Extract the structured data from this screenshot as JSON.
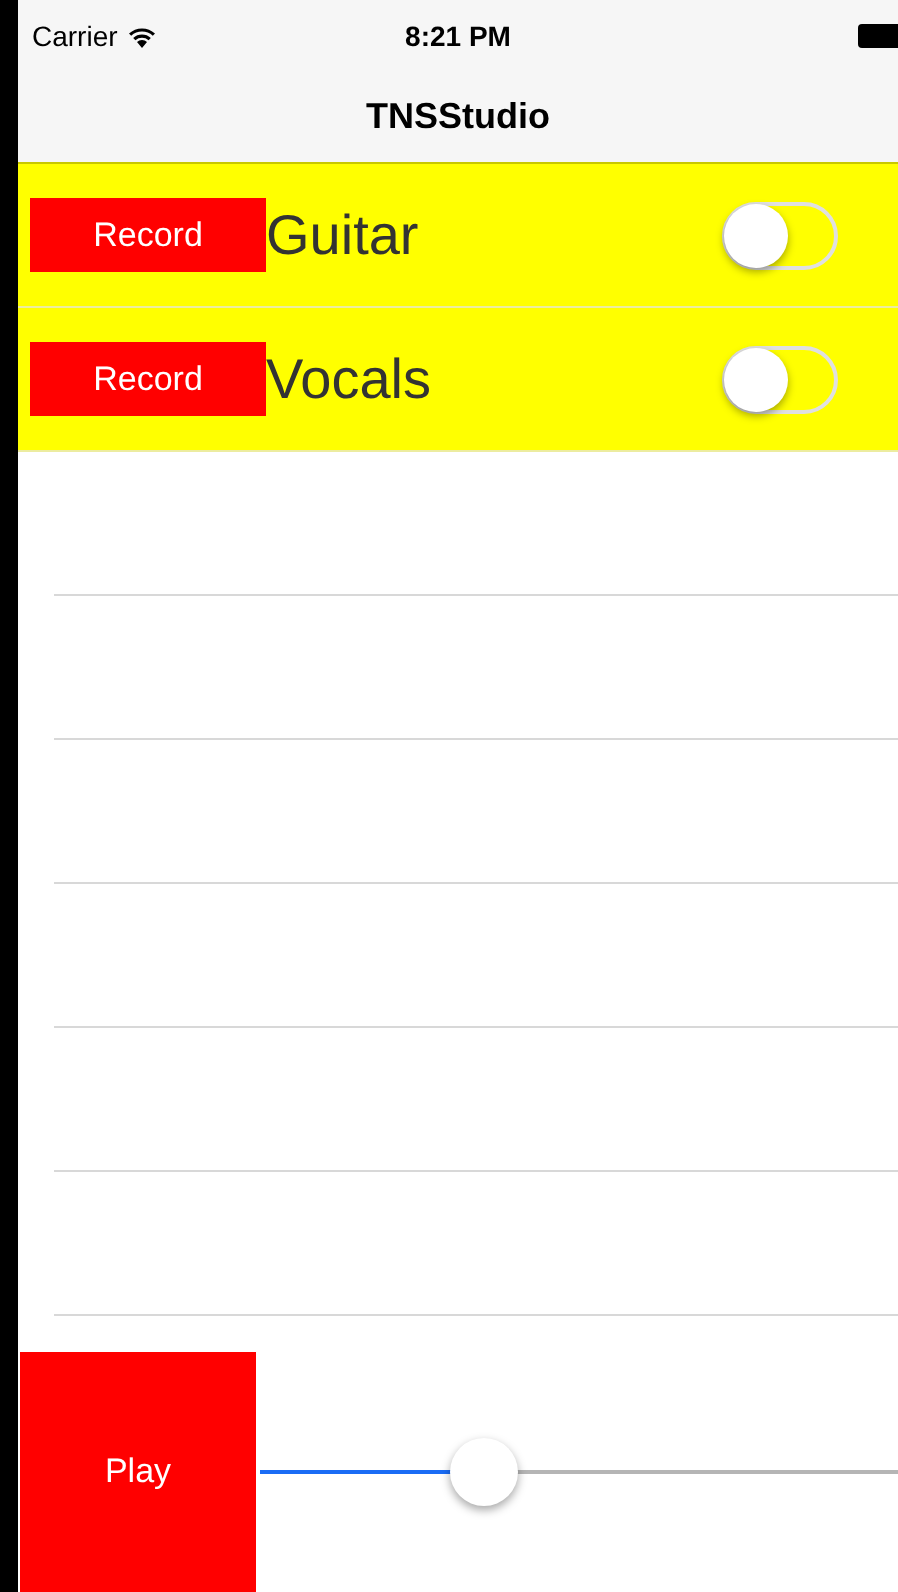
{
  "status_bar": {
    "carrier": "Carrier",
    "time": "8:21 PM"
  },
  "nav": {
    "title": "TNSStudio"
  },
  "tracks": [
    {
      "button": "Record",
      "name": "Guitar",
      "on": false
    },
    {
      "button": "Record",
      "name": "Vocals",
      "on": false
    }
  ],
  "player": {
    "button": "Play",
    "level": 0.35
  }
}
